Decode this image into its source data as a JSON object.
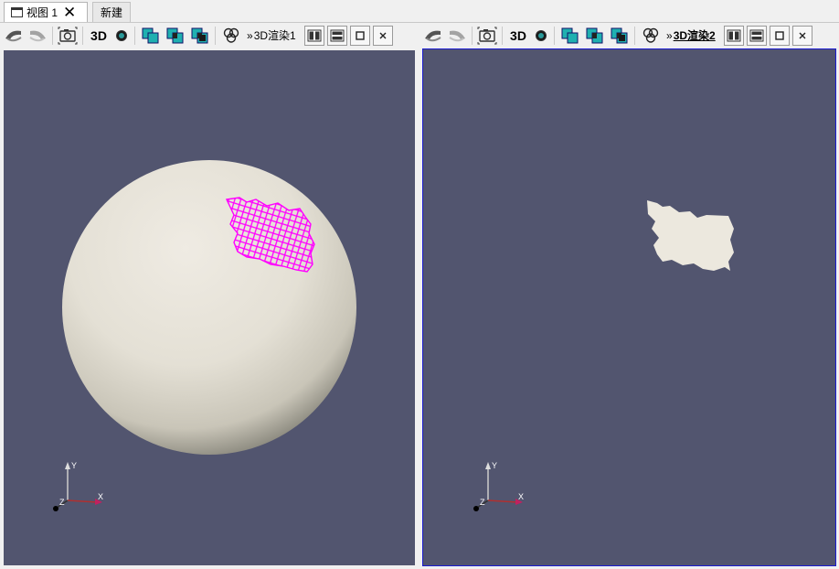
{
  "tabs": [
    {
      "label": "视图 1",
      "close": "✕"
    },
    {
      "label": "新建"
    }
  ],
  "views": [
    {
      "title": "3D渲染1",
      "prefix": "»",
      "mode": "3D",
      "active": false
    },
    {
      "title": "3D渲染2",
      "prefix": "»",
      "mode": "3D",
      "active": true
    }
  ],
  "axes": {
    "x": "X",
    "y": "Y",
    "z": "Z"
  },
  "colors": {
    "viewport_bg": "#52556f",
    "sphere": "#ece8de",
    "wireframe": "#ff00ff",
    "active_border": "#1b1bd0",
    "toolbar_cyan": "#1fb0b0"
  },
  "icons": [
    "back-icon",
    "forward-icon",
    "camera-icon",
    "circle-icon",
    "overlay-icon",
    "split-horizontal-icon",
    "split-vertical-icon",
    "maximize-icon",
    "close-icon"
  ]
}
